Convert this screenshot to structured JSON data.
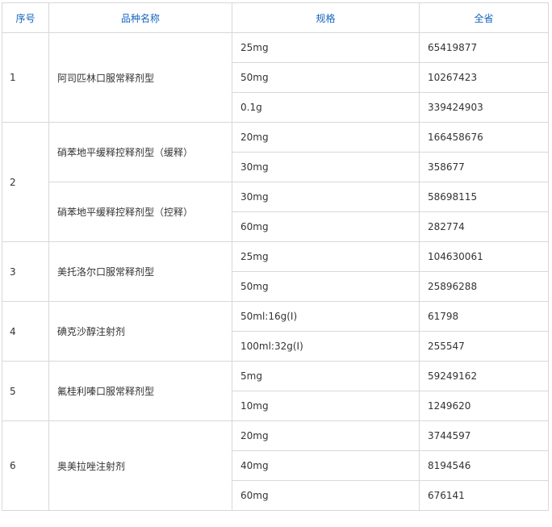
{
  "headers": {
    "no": "序号",
    "name": "品种名称",
    "spec": "规格",
    "amount": "全省"
  },
  "groups": [
    {
      "no": "1",
      "variants": [
        {
          "name": "阿司匹林口服常释剂型",
          "rows": [
            {
              "spec": "25mg",
              "amount": "65419877"
            },
            {
              "spec": "50mg",
              "amount": "10267423"
            },
            {
              "spec": "0.1g",
              "amount": "339424903"
            }
          ]
        }
      ]
    },
    {
      "no": "2",
      "variants": [
        {
          "name": "硝苯地平缓释控释剂型（缓释）",
          "rows": [
            {
              "spec": "20mg",
              "amount": "166458676"
            },
            {
              "spec": "30mg",
              "amount": "358677"
            }
          ]
        },
        {
          "name": "硝苯地平缓释控释剂型（控释）",
          "rows": [
            {
              "spec": "30mg",
              "amount": "58698115"
            },
            {
              "spec": "60mg",
              "amount": "282774"
            }
          ]
        }
      ]
    },
    {
      "no": "3",
      "variants": [
        {
          "name": "美托洛尔口服常释剂型",
          "rows": [
            {
              "spec": "25mg",
              "amount": "104630061"
            },
            {
              "spec": "50mg",
              "amount": "25896288"
            }
          ]
        }
      ]
    },
    {
      "no": "4",
      "variants": [
        {
          "name": "碘克沙醇注射剂",
          "rows": [
            {
              "spec": "50ml:16g(I)",
              "amount": "61798"
            },
            {
              "spec": "100ml:32g(I)",
              "amount": "255547"
            }
          ]
        }
      ]
    },
    {
      "no": "5",
      "variants": [
        {
          "name": "氟桂利嗪口服常释剂型",
          "rows": [
            {
              "spec": "5mg",
              "amount": "59249162"
            },
            {
              "spec": "10mg",
              "amount": "1249620"
            }
          ]
        }
      ]
    },
    {
      "no": "6",
      "variants": [
        {
          "name": "奥美拉唑注射剂",
          "rows": [
            {
              "spec": "20mg",
              "amount": "3744597"
            },
            {
              "spec": "40mg",
              "amount": "8194546"
            },
            {
              "spec": "60mg",
              "amount": "676141"
            }
          ]
        }
      ]
    }
  ]
}
